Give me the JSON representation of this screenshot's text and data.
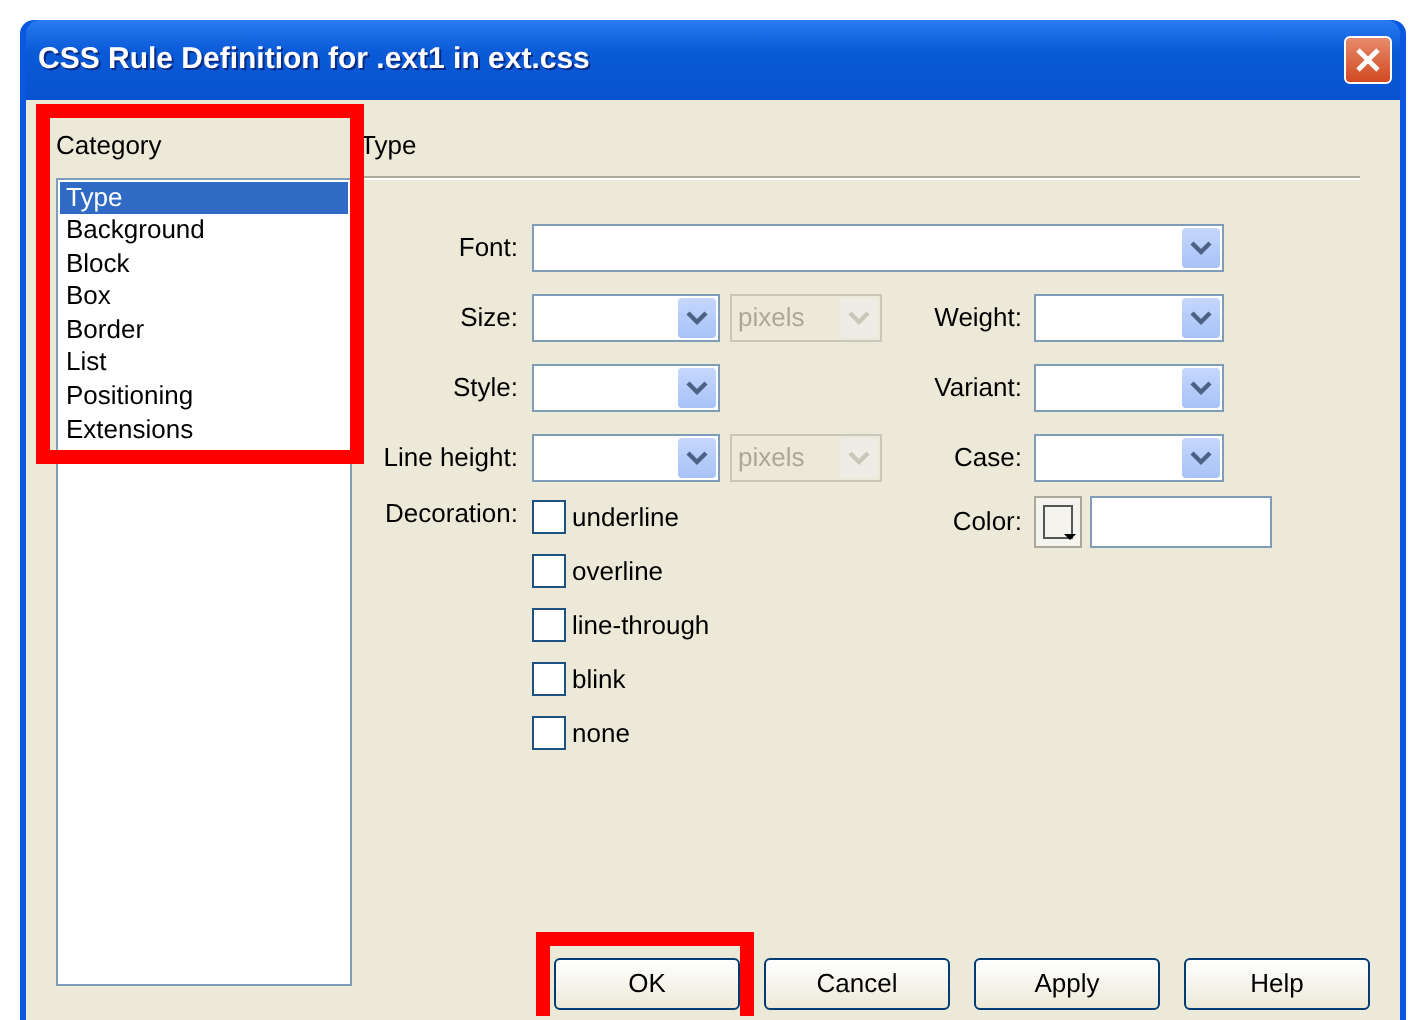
{
  "window": {
    "title": "CSS Rule Definition for .ext1 in ext.css"
  },
  "category": {
    "label": "Category",
    "highlighted": true,
    "items": [
      {
        "label": "Type",
        "selected": true
      },
      {
        "label": "Background",
        "selected": false
      },
      {
        "label": "Block",
        "selected": false
      },
      {
        "label": "Box",
        "selected": false
      },
      {
        "label": "Border",
        "selected": false
      },
      {
        "label": "List",
        "selected": false
      },
      {
        "label": "Positioning",
        "selected": false
      },
      {
        "label": "Extensions",
        "selected": false
      }
    ]
  },
  "panel": {
    "heading": "Type"
  },
  "rows": [
    {
      "kind": "wide",
      "label": "Font:"
    },
    {
      "kind": "pair",
      "label": "Size:",
      "unit": {
        "value": "pixels",
        "disabled": true
      },
      "right_label": "Weight:"
    },
    {
      "kind": "pair",
      "label": "Style:",
      "right_label": "Variant:"
    },
    {
      "kind": "pair",
      "label": "Line height:",
      "unit": {
        "value": "pixels",
        "disabled": true
      },
      "right_label": "Case:"
    }
  ],
  "decoration": {
    "label": "Decoration:",
    "options": [
      {
        "label": "underline",
        "checked": false
      },
      {
        "label": "overline",
        "checked": false
      },
      {
        "label": "line-through",
        "checked": false
      },
      {
        "label": "blink",
        "checked": false
      },
      {
        "label": "none",
        "checked": false
      }
    ]
  },
  "color": {
    "label": "Color:"
  },
  "buttons": [
    {
      "label": "OK",
      "highlighted": true
    },
    {
      "label": "Cancel",
      "highlighted": false
    },
    {
      "label": "Apply",
      "highlighted": false
    },
    {
      "label": "Help",
      "highlighted": false
    }
  ]
}
